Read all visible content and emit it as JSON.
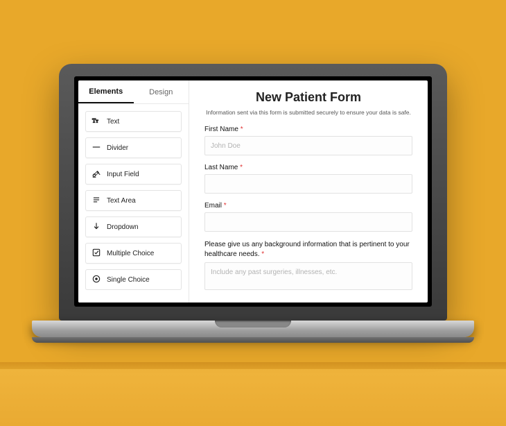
{
  "sidebar": {
    "tabs": [
      {
        "label": "Elements",
        "active": true
      },
      {
        "label": "Design",
        "active": false
      }
    ],
    "elements": [
      {
        "icon": "text-icon",
        "label": "Text"
      },
      {
        "icon": "divider-icon",
        "label": "Divider"
      },
      {
        "icon": "input-field-icon",
        "label": "Input Field"
      },
      {
        "icon": "text-area-icon",
        "label": "Text Area"
      },
      {
        "icon": "dropdown-icon",
        "label": "Dropdown"
      },
      {
        "icon": "multiple-choice-icon",
        "label": "Multiple Choice"
      },
      {
        "icon": "single-choice-icon",
        "label": "Single Choice"
      }
    ]
  },
  "form": {
    "title": "New Patient Form",
    "intro": "Information sent via this form is submitted securely to ensure your data is safe.",
    "required_marker": "*",
    "fields": {
      "first_name": {
        "label": "First Name",
        "placeholder": "John Doe",
        "required": true
      },
      "last_name": {
        "label": "Last Name",
        "placeholder": "",
        "required": true
      },
      "email": {
        "label": "Email",
        "placeholder": "",
        "required": true
      },
      "background": {
        "label": "Please give us any background information that is pertinent to your healthcare needs.",
        "placeholder": "Include any past surgeries, illnesses, etc.",
        "required": true
      }
    }
  }
}
